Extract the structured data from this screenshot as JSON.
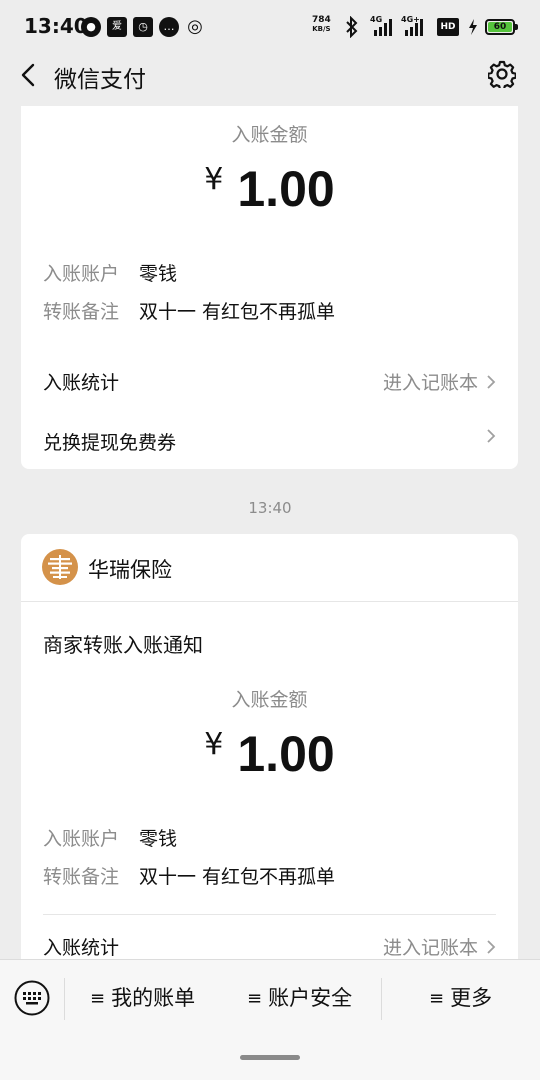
{
  "status_bar": {
    "time": "13:40",
    "net_speed_value": "784",
    "net_speed_unit": "KB/S",
    "signal_1_label": "4G",
    "signal_2_label": "4G+",
    "hd_label": "HD",
    "battery_level": "60",
    "notification_icons": [
      "wechat-icon",
      "fans-icon",
      "alarm-icon",
      "message-icon",
      "hotspot-icon"
    ]
  },
  "nav": {
    "title": "微信支付",
    "back_icon": "chevron-left-icon",
    "settings_icon": "gear-icon"
  },
  "card1": {
    "amount_label": "入账金额",
    "currency": "¥",
    "amount": "1.00",
    "account_key": "入账账户",
    "account_val": "零钱",
    "remark_key": "转账备注",
    "remark_val": "双十一 有红包不再孤单",
    "stats_label": "入账统计",
    "stats_link": "进入记账本",
    "coupon_label": "兑换提现免费券"
  },
  "timestamp": "13:40",
  "card2": {
    "merchant_name": "华瑞保险",
    "notice_title": "商家转账入账通知",
    "amount_label": "入账金额",
    "currency": "¥",
    "amount": "1.00",
    "account_key": "入账账户",
    "account_val": "零钱",
    "remark_key": "转账备注",
    "remark_val": "双十一 有红包不再孤单",
    "stats_label": "入账统计",
    "stats_link": "进入记账本"
  },
  "bottom_menu": {
    "keyboard_icon": "keyboard-icon",
    "items": [
      {
        "icon": "≡",
        "label": "我的账单"
      },
      {
        "icon": "≡",
        "label": "账户安全"
      },
      {
        "icon": "≡",
        "label": "更多"
      }
    ]
  },
  "colors": {
    "background": "#ededed",
    "card": "#ffffff",
    "secondary_text": "#8c8c8c",
    "battery": "#56c43d",
    "merchant_logo": "#d4924a"
  }
}
